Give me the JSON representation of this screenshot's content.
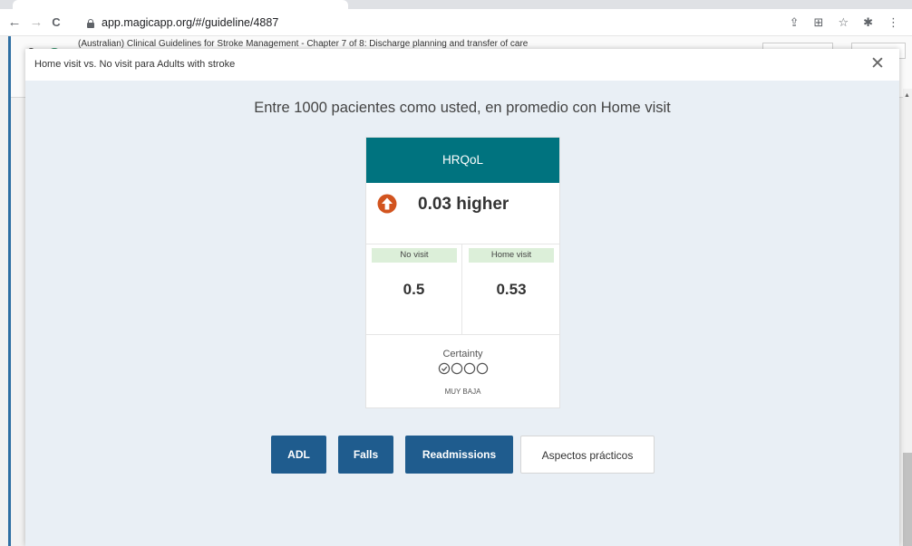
{
  "browser": {
    "url": "app.magicapp.org/#/guideline/4887",
    "back_icon": "arrow-left-icon",
    "forward_icon": "arrow-right-icon",
    "reload_icon": "reload-icon",
    "nav_back": "←",
    "nav_forward": "→",
    "nav_reload": "C"
  },
  "background_page": {
    "title": "(Australian) Clinical Guidelines for Stroke Management - Chapter 7 of 8: Discharge planning and transfer of care",
    "side_letter": "S"
  },
  "modal": {
    "title": "Home visit vs. No visit para Adults with stroke",
    "close_glyph": "✕",
    "headline": "Entre 1000 pacientes como usted, en promedio con Home visit",
    "card": {
      "outcome": "HRQoL",
      "effect": "0.03 higher",
      "effect_icon": "arrow-up-circle-icon",
      "comparator_label": "No visit",
      "comparator_value": "0.5",
      "intervention_label": "Home visit",
      "intervention_value": "0.53",
      "certainty_label": "Certainty",
      "certainty_grade": "MUY BAJA",
      "certainty_level": 1,
      "certainty_max": 4
    },
    "buttons": [
      {
        "label": "ADL",
        "style": "primary"
      },
      {
        "label": "Falls",
        "style": "primary"
      },
      {
        "label": "Readmissions",
        "style": "primary"
      },
      {
        "label": "Aspectos prácticos",
        "style": "secondary"
      }
    ]
  },
  "colors": {
    "card_header": "#00737f",
    "effect_arrow": "#d2541f",
    "chip_bg": "#dcefd9",
    "primary_button": "#1f5c8e",
    "modal_bg": "#e9eff5"
  }
}
